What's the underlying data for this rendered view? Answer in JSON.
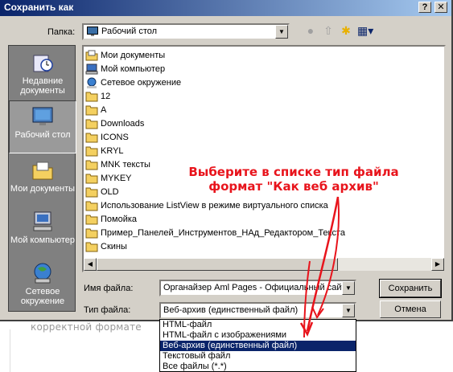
{
  "background": {
    "text": "корректной формате"
  },
  "dialog": {
    "title": "Сохранить как",
    "help_button": "?",
    "close_button": "✕",
    "folder_label": "Папка:",
    "folder_value": "Рабочий стол",
    "places": [
      {
        "label": "Недавние документы",
        "icon": "recent-documents-icon"
      },
      {
        "label": "Рабочий стол",
        "icon": "desktop-icon",
        "active": true
      },
      {
        "label": "Мои документы",
        "icon": "my-documents-icon"
      },
      {
        "label": "Мой компьютер",
        "icon": "my-computer-icon"
      },
      {
        "label": "Сетевое окружение",
        "icon": "network-icon"
      }
    ],
    "files": [
      {
        "name": "Мои документы",
        "icon": "my-documents-icon"
      },
      {
        "name": "Мой компьютер",
        "icon": "my-computer-icon"
      },
      {
        "name": "Сетевое окружение",
        "icon": "network-icon"
      },
      {
        "name": "12",
        "icon": "folder-icon"
      },
      {
        "name": "A",
        "icon": "folder-icon"
      },
      {
        "name": "Downloads",
        "icon": "folder-icon"
      },
      {
        "name": "ICONS",
        "icon": "folder-icon"
      },
      {
        "name": "KRYL",
        "icon": "folder-icon"
      },
      {
        "name": "MNK тексты",
        "icon": "folder-icon"
      },
      {
        "name": "MYKEY",
        "icon": "folder-icon"
      },
      {
        "name": "OLD",
        "icon": "folder-icon"
      },
      {
        "name": "Использование ListView в режиме виртуального списка",
        "icon": "folder-icon"
      },
      {
        "name": "Помойка",
        "icon": "folder-icon"
      },
      {
        "name": "Пример_Панелей_Инструментов_НАд_Редактором_Текста",
        "icon": "folder-icon"
      },
      {
        "name": "Скины",
        "icon": "folder-icon"
      }
    ],
    "filename_label": "Имя файла:",
    "filename_value": "Органайзер Aml Pages - Официальный сайт",
    "filetype_label": "Тип файла:",
    "filetype_value": "Веб-архив (единственный файл)",
    "save_button": "Сохранить",
    "cancel_button": "Отмена",
    "filetype_options": [
      "HTML-файл",
      "HTML-файл с изображениями",
      "Веб-архив (единственный файл)",
      "Текстовый файл",
      "Все файлы (*.*)"
    ],
    "selected_option_index": 2
  },
  "annotation": {
    "line1": "Выберите в списке тип файла",
    "line2": "формат \"Как веб архив\"",
    "color": "#e8141c"
  }
}
